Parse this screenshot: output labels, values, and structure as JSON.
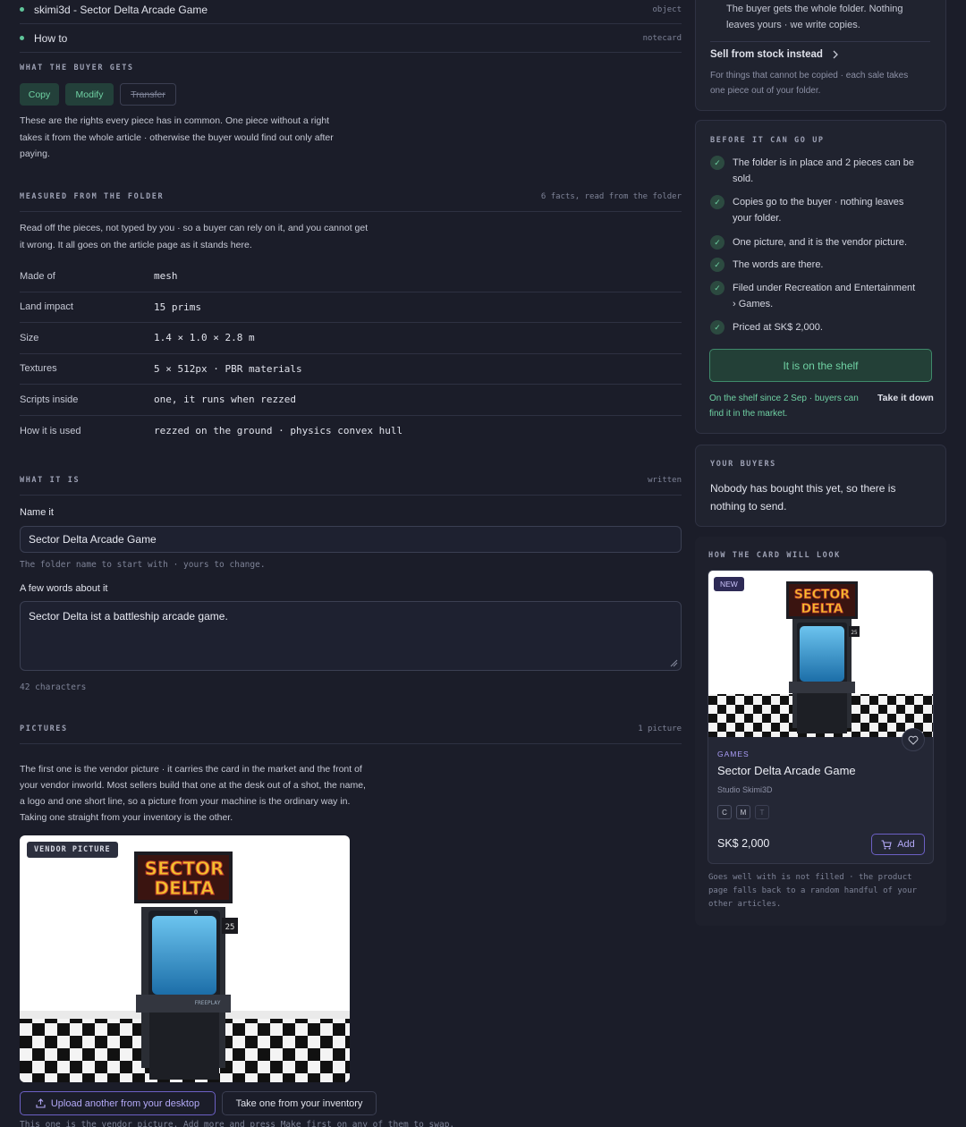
{
  "contents": [
    {
      "name": "skimi3d - Sector Delta Arcade Game",
      "kind": "object"
    },
    {
      "name": "How to",
      "kind": "notecard"
    }
  ],
  "rights": {
    "label": "WHAT THE BUYER GETS",
    "chips": [
      {
        "label": "Copy",
        "enabled": true
      },
      {
        "label": "Modify",
        "enabled": true
      },
      {
        "label": "Transfer",
        "enabled": false
      }
    ],
    "note_lines": [
      "These are the rights every piece has in common. One piece without a right",
      "takes it from the whole article · otherwise the buyer would find out only after",
      "paying."
    ]
  },
  "measured": {
    "label": "MEASURED FROM THE FOLDER",
    "meta": "6 facts, read from the folder",
    "intro_lines": [
      "Read off the pieces, not typed by you · so a buyer can rely on it, and you cannot get",
      "it wrong. It all goes on the article page as it stands here."
    ],
    "facts": [
      {
        "key": "Made of",
        "value": "mesh"
      },
      {
        "key": "Land impact",
        "value": "15 prims"
      },
      {
        "key": "Size",
        "value": "1.4 × 1.0 × 2.8 m"
      },
      {
        "key": "Textures",
        "value": "5 × 512px · PBR materials"
      },
      {
        "key": "Scripts inside",
        "value": "one, it runs when rezzed"
      },
      {
        "key": "How it is used",
        "value": "rezzed on the ground · physics convex hull"
      }
    ]
  },
  "what": {
    "label": "WHAT IT IS",
    "meta": "written",
    "name_label": "Name it",
    "name_value": "Sector Delta Arcade Game",
    "name_hint": "The folder name to start with · yours to change.",
    "desc_label": "A few words about it",
    "desc_value": "Sector Delta ist a battleship arcade game.",
    "char_count": "42 characters"
  },
  "pictures": {
    "label": "PICTURES",
    "meta": "1 picture",
    "intro_lines": [
      "The first one is the vendor picture · it carries the card in the market and the front of",
      "your vendor inworld. Most sellers build that one at the desk out of a shot, the name,",
      "a logo and one short line, so a picture from your machine is the ordinary way in.",
      "Taking one straight from your inventory is the other."
    ],
    "vendor_tag": "VENDOR PICTURE",
    "upload_label": "Upload another from your desktop",
    "inventory_label": "Take one from your inventory",
    "footer_note": "This one is the vendor picture. Add more and press Make first on any of them to swap."
  },
  "arcade_art": {
    "marquee_line1": "SECTOR",
    "marquee_line2": "DELTA",
    "score": "25",
    "freeplay": "FREEPLAY",
    "digit": "0"
  },
  "delivery": {
    "copy_lines": [
      "The buyer gets the whole folder. Nothing",
      "leaves yours · we write copies."
    ],
    "stock_link": "Sell from stock instead",
    "stock_lines": [
      "For things that cannot be copied · each sale takes",
      "one piece out of your folder."
    ]
  },
  "checklist": {
    "label": "BEFORE IT CAN GO UP",
    "items": [
      {
        "lines": [
          "The folder is in place and 2 pieces can be",
          "sold."
        ]
      },
      {
        "lines": [
          "Copies go to the buyer · nothing leaves",
          "your folder."
        ]
      },
      {
        "lines": [
          "One picture, and it is the vendor picture."
        ]
      },
      {
        "lines": [
          "The words are there."
        ]
      },
      {
        "lines": [
          "Filed under Recreation and Entertainment",
          "› Games."
        ]
      },
      {
        "lines": [
          "Priced at SK$ 2,000."
        ]
      }
    ],
    "shelf_button": "It is on the shelf",
    "since_lines": [
      "On the shelf since 2 Sep · buyers can",
      "find it in the market."
    ],
    "take_down": "Take it down"
  },
  "buyers": {
    "label": "YOUR BUYERS",
    "lines": [
      "Nobody has bought this yet, so there is",
      "nothing to send."
    ]
  },
  "preview": {
    "label": "HOW THE CARD WILL LOOK",
    "badge": "NEW",
    "category": "GAMES",
    "title": "Sector Delta Arcade Game",
    "store": "Studio Skimi3D",
    "perm_badges": [
      "C",
      "M",
      "T"
    ],
    "price": "SK$ 2,000",
    "add_label": "Add",
    "note_lines": [
      "Goes well with is not filled · the product",
      "page falls back to a random handful of your",
      "other articles."
    ]
  },
  "colors": {
    "background": "#1b1d29",
    "accent_green": "#6fd1a3",
    "accent_purple": "#a99cf5"
  }
}
